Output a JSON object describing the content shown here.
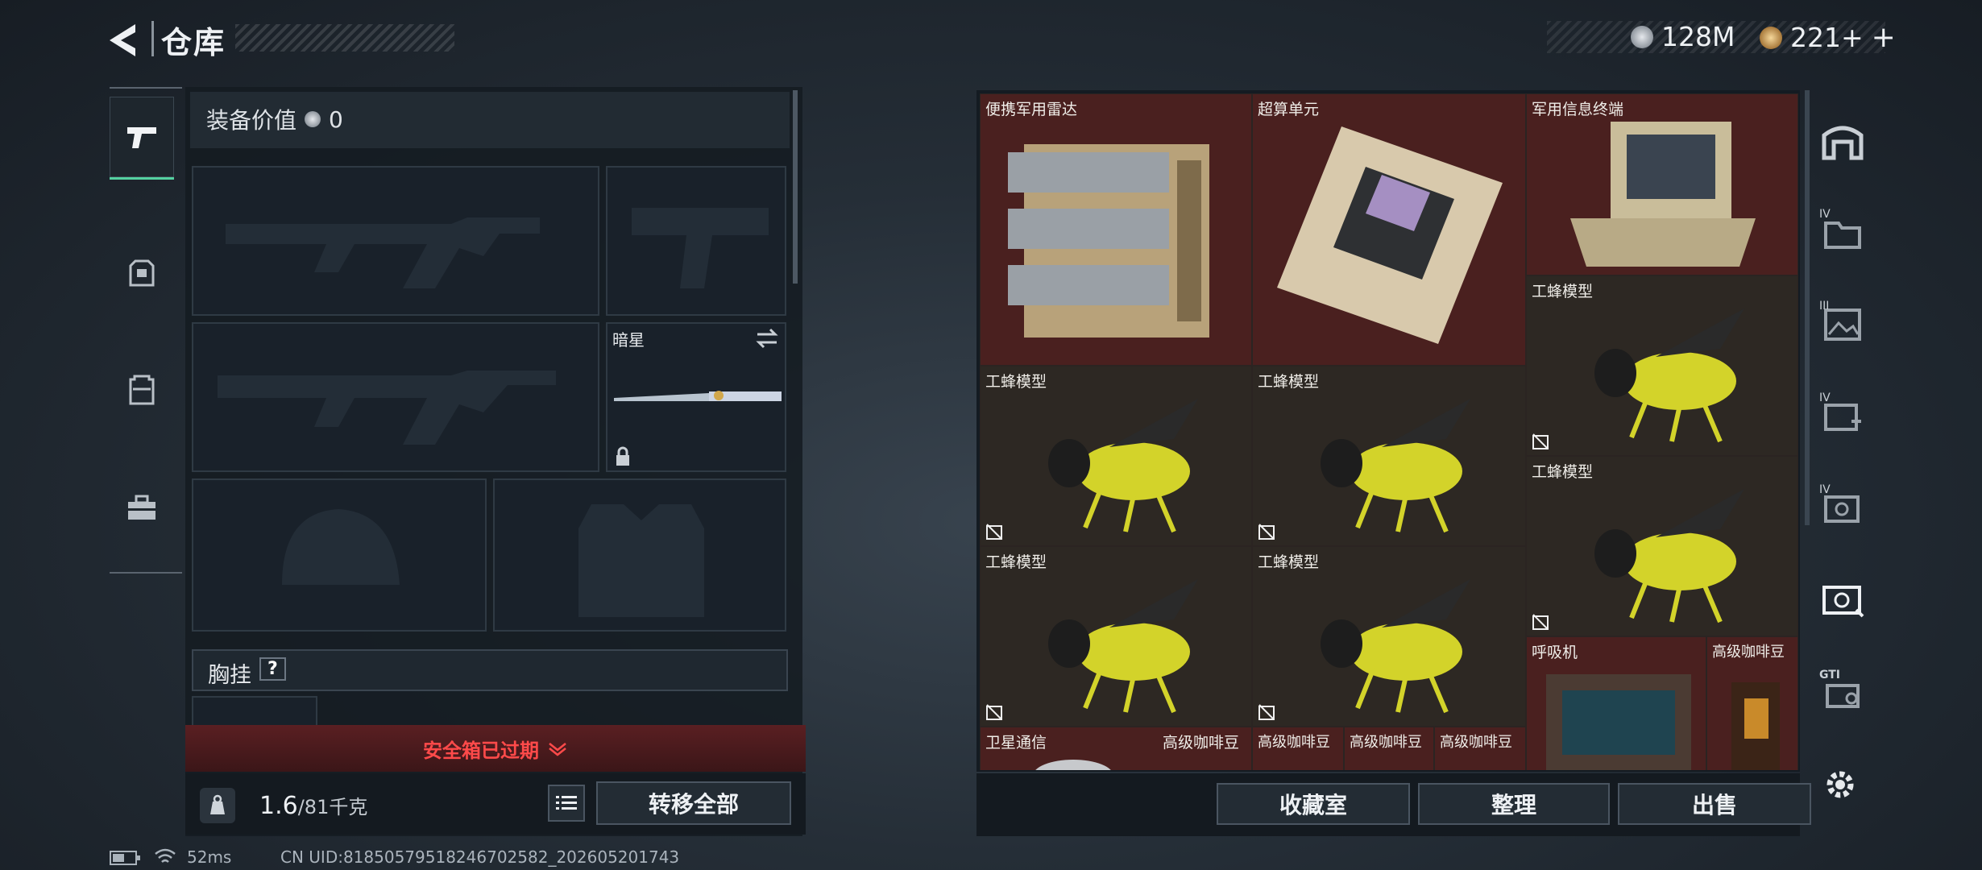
{
  "header": {
    "title": "仓库",
    "currency_a": "128M",
    "currency_b": "221+"
  },
  "left_tabs": [
    "weapon-tab",
    "backpack-tab",
    "vest-tab",
    "toolbox-tab"
  ],
  "equip": {
    "value_label": "装备价值",
    "value": "0",
    "knife_name": "暗星",
    "chest_rig_label": "胸挂",
    "help": "?",
    "safe_box_status": "安全箱已过期",
    "weight_current": "1.6",
    "weight_max": "/81千克",
    "transfer_all": "转移全部"
  },
  "storage_items": [
    {
      "name": "便携军用雷达"
    },
    {
      "name": "超算单元"
    },
    {
      "name": "军用信息终端"
    },
    {
      "name": "工蜂模型"
    },
    {
      "name": "工蜂模型"
    },
    {
      "name": "工蜂模型"
    },
    {
      "name": "工蜂模型"
    },
    {
      "name": "工蜂模型"
    },
    {
      "name": "工蜂模型"
    },
    {
      "name": "呼吸机"
    },
    {
      "name": "高级咖啡豆"
    },
    {
      "name": "卫星通信"
    },
    {
      "name": "高级咖啡豆"
    },
    {
      "name": "高级咖啡豆"
    },
    {
      "name": "高级咖啡豆"
    },
    {
      "name": "高级咖啡豆"
    }
  ],
  "right_buttons": {
    "collection": "收藏室",
    "organize": "整理",
    "sell": "出售"
  },
  "right_tab_labels": [
    "",
    "IV",
    "III",
    "IV",
    "IV",
    "",
    "GTI"
  ],
  "status": {
    "ping": "52ms",
    "uid": "CN UID:81850579518246702582_202605201743"
  },
  "colors": {
    "accent": "#54d1a0",
    "alert": "#ff4a4a",
    "gold_slot": "#4a201f"
  }
}
